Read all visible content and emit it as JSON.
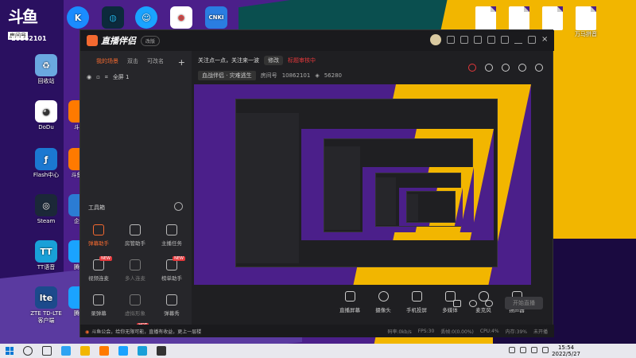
{
  "desktop": {
    "logo_text": "斗鱼",
    "logo_sub": "房间号",
    "room_id": "10862101",
    "icons": [
      {
        "label": "回收站",
        "glyph": "♻",
        "color": "#6aa8e0"
      },
      {
        "label": "DoDu",
        "glyph": "◕",
        "color": "#ffffff"
      },
      {
        "label": "斗鱼",
        "glyph": "",
        "color": "#ff7a00"
      },
      {
        "label": "Flash中心",
        "glyph": "ƒ",
        "color": "#1b78d1"
      },
      {
        "label": "斗鱼直",
        "glyph": "",
        "color": "#ff7a00"
      },
      {
        "label": "Steam",
        "glyph": "◎",
        "color": "#1b2838"
      },
      {
        "label": "企业",
        "glyph": "",
        "color": "#2b7cd3"
      },
      {
        "label": "TT语音",
        "glyph": "TT",
        "color": "#19a0d8"
      },
      {
        "label": "腾讯",
        "glyph": "",
        "color": "#1aa3ff"
      },
      {
        "label": "ZTE TD-LTE 客户端",
        "glyph": "lte",
        "color": "#1c4a8c"
      },
      {
        "label": "腾讯",
        "glyph": "",
        "color": "#1aa3ff"
      }
    ],
    "top_icons": [
      {
        "label": "",
        "glyph": "K",
        "color": "#1a8cff"
      },
      {
        "label": "",
        "glyph": "◍",
        "color": "#0c2a3c"
      },
      {
        "label": "",
        "glyph": "☺",
        "color": "#1aa3ff"
      },
      {
        "label": "",
        "glyph": "⊕",
        "color": "#ffffff"
      },
      {
        "label": "",
        "glyph": "CNKI",
        "color": "#2a7de1"
      }
    ],
    "files": [
      {
        "label": ""
      },
      {
        "label": ""
      },
      {
        "label": ""
      },
      {
        "label": "万马拼音"
      }
    ]
  },
  "app": {
    "name": "直播伴侣",
    "version_tag": "改版",
    "tabs": [
      "我的场景",
      "双击",
      "可改名"
    ],
    "scene_name": "全屏 1",
    "toolbox_title": "工具箱",
    "tools": [
      {
        "label": "弹幕助手",
        "state": "active",
        "badge": ""
      },
      {
        "label": "房管助手",
        "state": "normal",
        "badge": ""
      },
      {
        "label": "主播任务",
        "state": "normal",
        "badge": ""
      },
      {
        "label": "视频连麦",
        "state": "normal",
        "badge": "NEW"
      },
      {
        "label": "多人连麦",
        "state": "dim",
        "badge": ""
      },
      {
        "label": "榜单助手",
        "state": "normal",
        "badge": "NEW"
      },
      {
        "label": "录弹幕",
        "state": "normal",
        "badge": ""
      },
      {
        "label": "虚拟形象",
        "state": "dim",
        "badge": ""
      },
      {
        "label": "弹幕秀",
        "state": "normal",
        "badge": ""
      },
      {
        "label": "",
        "state": "normal",
        "badge": ""
      },
      {
        "label": "",
        "state": "normal",
        "badge": "HOT"
      }
    ],
    "title_line": "关注点一点，关注来一波",
    "edit_label": "修改",
    "warning": "标题审核中",
    "category": "血战伴侣 · 灾难逃生",
    "room_label": "房间号",
    "room_id": "10862101",
    "followers": "56280",
    "bottom_tools": [
      "直播屏幕",
      "摄像头",
      "手机投屏",
      "多媒体",
      "麦克风",
      "扬声器"
    ],
    "go_live": "开始直播",
    "notice": "斗鱼公会，给你无限可能，直播有收益，更上一层楼",
    "status": [
      "码率:0kb/s",
      "FPS:30",
      "丢帧:0(0.00%)",
      "CPU:4%",
      "内存:39%",
      "未开播"
    ]
  },
  "taskbar": {
    "time": "15:54",
    "date": "2022/5/27"
  }
}
